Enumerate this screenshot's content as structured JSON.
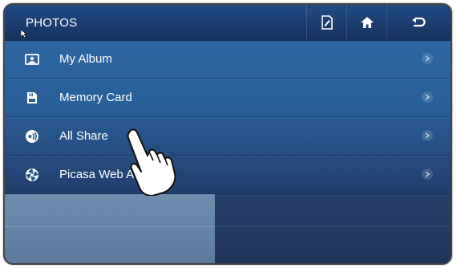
{
  "header": {
    "title": "PHOTOS",
    "buttons": [
      {
        "name": "edit",
        "icon": "edit-icon"
      },
      {
        "name": "home",
        "icon": "home-icon"
      },
      {
        "name": "back",
        "icon": "back-icon"
      }
    ]
  },
  "menu": {
    "items": [
      {
        "label": "My Album",
        "icon": "album-icon"
      },
      {
        "label": "Memory Card",
        "icon": "memory-card-icon"
      },
      {
        "label": "All Share",
        "icon": "allshare-icon"
      },
      {
        "label": "Picasa Web A",
        "icon": "picasa-icon"
      }
    ]
  },
  "colors": {
    "title_bar": "#1b3e6f",
    "list_background": "#2a5f98",
    "text": "#ffffff"
  }
}
